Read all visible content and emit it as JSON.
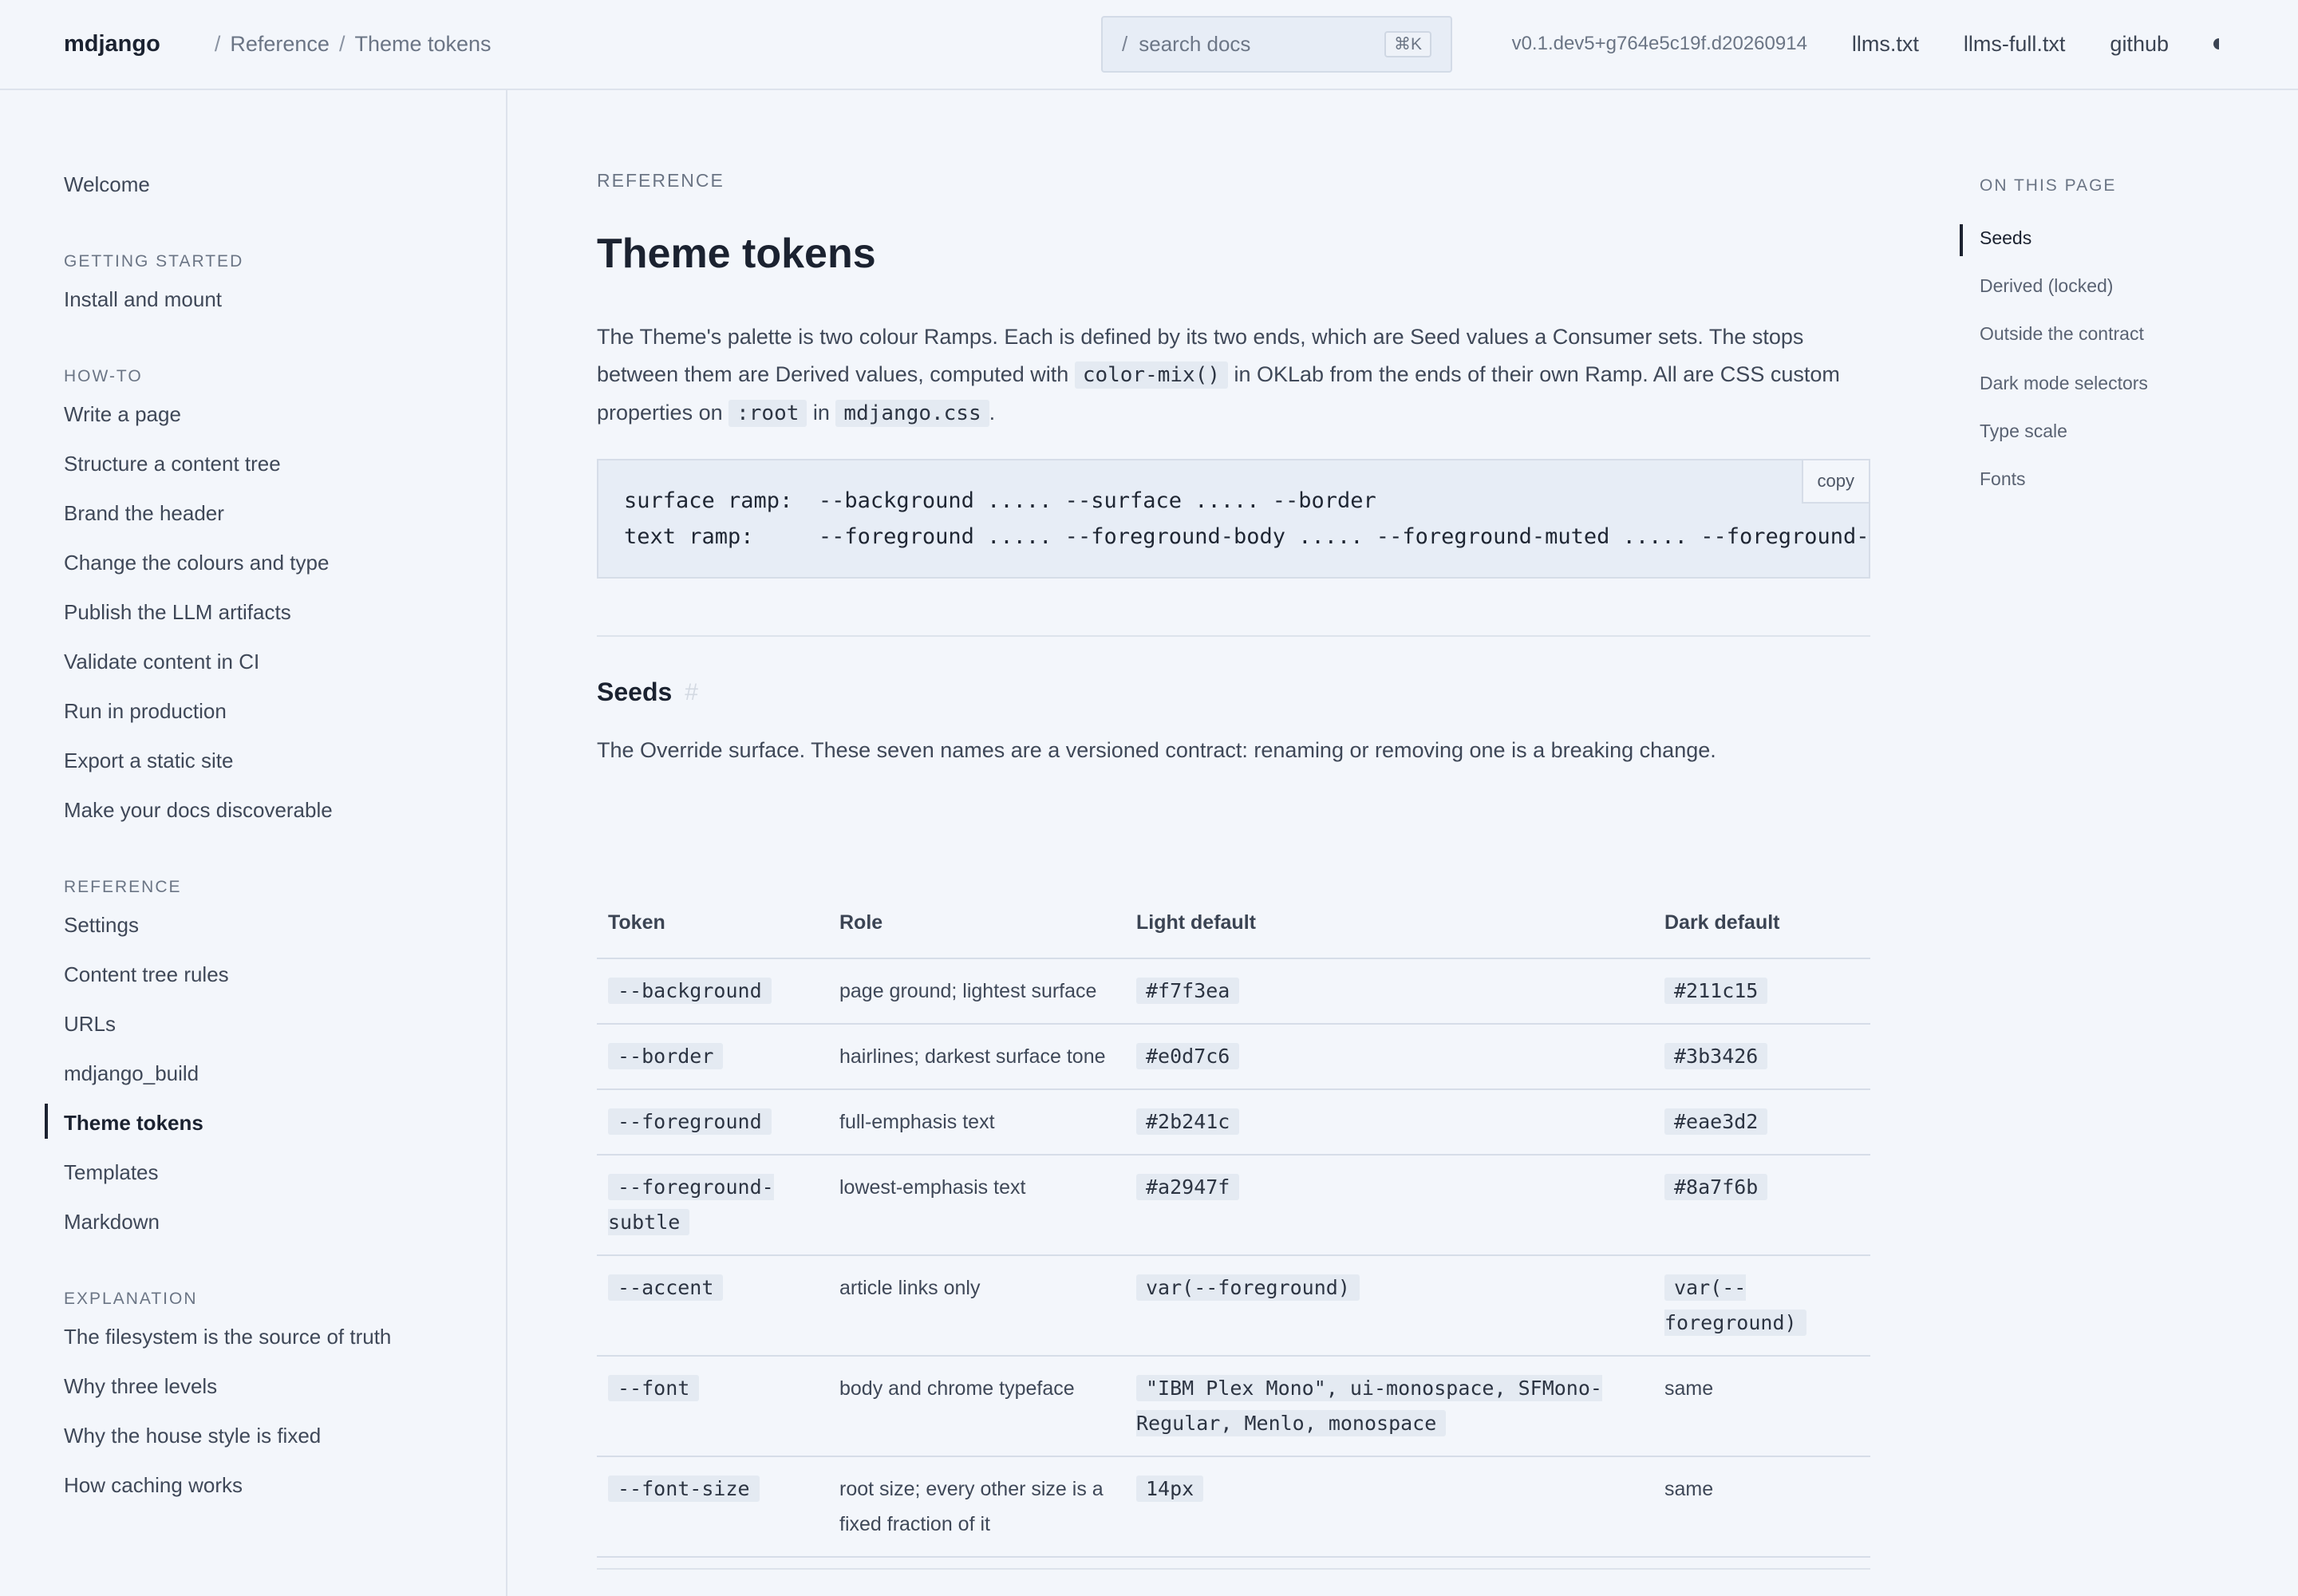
{
  "header": {
    "brand": "mdjango",
    "breadcrumb": [
      "Reference",
      "Theme tokens"
    ],
    "search": {
      "slash": "/",
      "placeholder": "search docs",
      "shortcut": "⌘K"
    },
    "version": "v0.1.dev5+g764e5c19f.d20260914",
    "links": [
      "llms.txt",
      "llms-full.txt",
      "github"
    ]
  },
  "sidebar": {
    "top": "Welcome",
    "sections": [
      {
        "title": "GETTING STARTED",
        "items": [
          "Install and mount"
        ]
      },
      {
        "title": "HOW-TO",
        "items": [
          "Write a page",
          "Structure a content tree",
          "Brand the header",
          "Change the colours and type",
          "Publish the LLM artifacts",
          "Validate content in CI",
          "Run in production",
          "Export a static site",
          "Make your docs discoverable"
        ]
      },
      {
        "title": "REFERENCE",
        "items": [
          "Settings",
          "Content tree rules",
          "URLs",
          "mdjango_build",
          "Theme tokens",
          "Templates",
          "Markdown"
        ]
      },
      {
        "title": "EXPLANATION",
        "items": [
          "The filesystem is the source of truth",
          "Why three levels",
          "Why the house style is fixed",
          "How caching works"
        ]
      }
    ],
    "active": "Theme tokens"
  },
  "main": {
    "eyebrow": "REFERENCE",
    "title": "Theme tokens",
    "lead": {
      "p1": "The Theme's palette is two colour Ramps. Each is defined by its two ends, which are Seed values a Consumer sets. The stops between them are Derived values, computed with ",
      "code1": "color-mix()",
      "p2": " in OKLab from the ends of their own Ramp. All are CSS custom properties on ",
      "code2": ":root",
      "p3": " in ",
      "code3": "mdjango.css",
      "p4": "."
    },
    "codeblock": {
      "line1": "surface ramp:  --background ..... --surface ..... --border",
      "line2": "text ramp:     --foreground ..... --foreground-body ..... --foreground-muted ..... --foreground-subtle",
      "copy": "copy"
    },
    "seeds": {
      "heading": "Seeds",
      "anchor": "#",
      "intro": "The Override surface. These seven names are a versioned contract: renaming or removing one is a breaking change.",
      "columns": [
        "Token",
        "Role",
        "Light default",
        "Dark default"
      ],
      "rows": [
        {
          "token": "--background",
          "role": "page ground; lightest surface",
          "light": "#f7f3ea",
          "dark": "#211c15"
        },
        {
          "token": "--border",
          "role": "hairlines; darkest surface tone",
          "light": "#e0d7c6",
          "dark": "#3b3426"
        },
        {
          "token": "--foreground",
          "role": "full-emphasis text",
          "light": "#2b241c",
          "dark": "#eae3d2"
        },
        {
          "token": "--foreground-subtle",
          "role": "lowest-emphasis text",
          "light": "#a2947f",
          "dark": "#8a7f6b"
        },
        {
          "token": "--accent",
          "role": "article links only",
          "light": "var(--foreground)",
          "dark": "var(--foreground)"
        },
        {
          "token": "--font",
          "role": "body and chrome typeface",
          "light": "\"IBM Plex Mono\", ui-monospace, SFMono-Regular, Menlo, monospace",
          "dark": "same"
        },
        {
          "token": "--font-size",
          "role": "root size; every other size is a fixed fraction of it",
          "light": "14px",
          "dark": "same"
        }
      ]
    }
  },
  "toc": {
    "title": "ON THIS PAGE",
    "items": [
      "Seeds",
      "Derived (locked)",
      "Outside the contract",
      "Dark mode selectors",
      "Type scale",
      "Fonts"
    ],
    "active": "Seeds"
  }
}
